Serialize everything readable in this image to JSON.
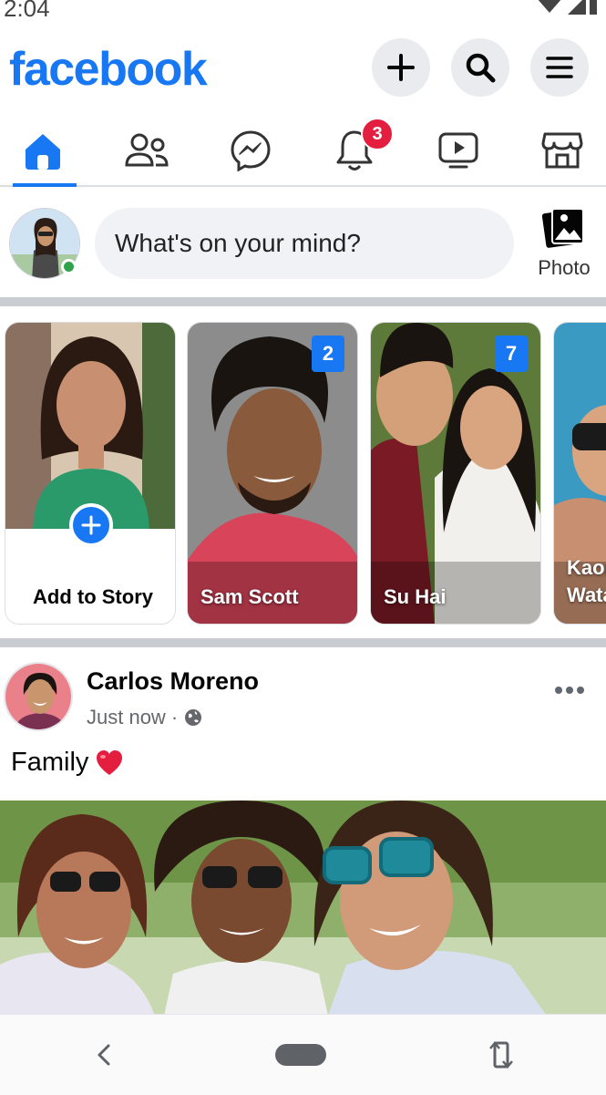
{
  "status": {
    "time": "2:04"
  },
  "header": {
    "logo": "facebook",
    "buttons": [
      "plus-icon",
      "search-icon",
      "menu-icon"
    ]
  },
  "tabs": [
    {
      "name": "home",
      "icon": "home-icon",
      "active": true
    },
    {
      "name": "friends",
      "icon": "friends-icon"
    },
    {
      "name": "messenger",
      "icon": "messenger-icon"
    },
    {
      "name": "notifications",
      "icon": "bell-icon",
      "badge": "3"
    },
    {
      "name": "watch",
      "icon": "watch-icon"
    },
    {
      "name": "marketplace",
      "icon": "marketplace-icon"
    }
  ],
  "composer": {
    "placeholder": "What's on your mind?",
    "photo_label": "Photo"
  },
  "stories": [
    {
      "label": "Add to Story"
    },
    {
      "label": "Sam Scott",
      "count": "2"
    },
    {
      "label": "Su Hai",
      "count": "7"
    },
    {
      "label": "Kaor\nWata"
    }
  ],
  "post": {
    "author": "Carlos Moreno",
    "time": "Just now",
    "separator": "·",
    "text": "Family",
    "emoji": "❤️"
  },
  "colors": {
    "brand": "#1877f2",
    "badge": "#e41e3f",
    "online": "#31a24c",
    "muted": "#65676b"
  }
}
